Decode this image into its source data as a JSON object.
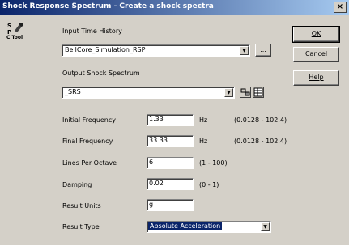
{
  "window": {
    "title": "Shock Response Spectrum - Create a shock spectra",
    "close_label": "×"
  },
  "tool": {
    "icon_label": "C Tool"
  },
  "input": {
    "label": "Input Time History",
    "value": "BellCore_Simulation_RSP",
    "browse_label": "..."
  },
  "output": {
    "label": "Output Shock Spectrum",
    "value": "_SRS"
  },
  "params": [
    {
      "label": "Initial Frequency",
      "value": "1.33",
      "unit": "Hz",
      "range": "(0.0128 - 102.4)"
    },
    {
      "label": "Final Frequency",
      "value": "33.33",
      "unit": "Hz",
      "range": "(0.0128 - 102.4)"
    },
    {
      "label": "Lines Per Octave",
      "value": "6",
      "unit": "",
      "range": "(1 - 100)"
    },
    {
      "label": "Damping",
      "value": "0.02",
      "unit": "",
      "range": "(0 - 1)"
    },
    {
      "label": "Result Units",
      "value": "g",
      "unit": "",
      "range": ""
    }
  ],
  "result_type": {
    "label": "Result Type",
    "value": "Absolute Acceleration"
  },
  "buttons": {
    "ok": "OK",
    "cancel": "Cancel",
    "help": "Help"
  },
  "colors": {
    "title_bar": "#0a246a",
    "dialog_bg": "#d4d0c8",
    "selection": "#0a246a"
  }
}
